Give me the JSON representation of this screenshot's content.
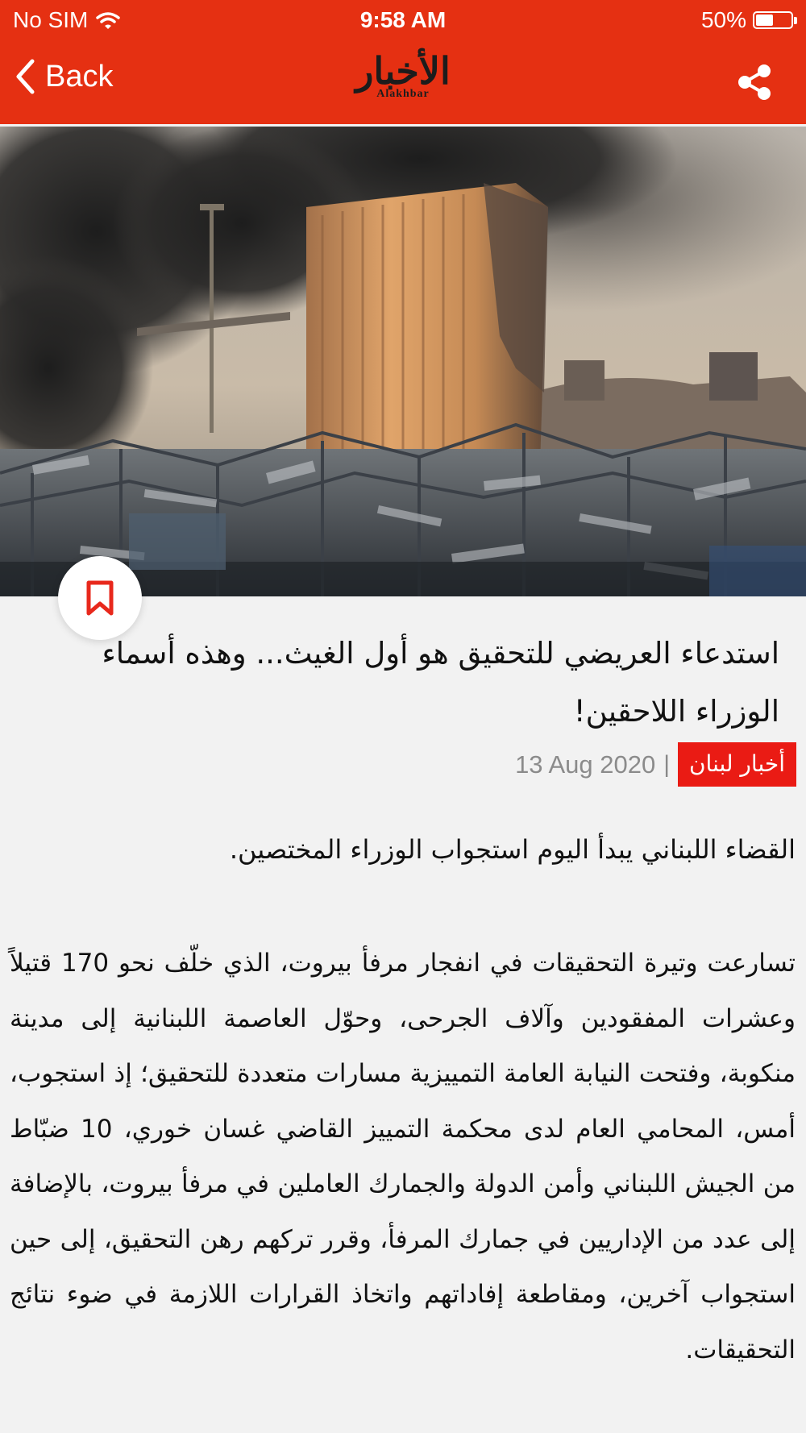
{
  "status_bar": {
    "carrier": "No SIM",
    "time": "9:58 AM",
    "battery": "50%",
    "battery_level": 0.5
  },
  "nav": {
    "back_label": "Back",
    "logo_arabic": "الأخبار",
    "logo_latin": "Alakhbar"
  },
  "icons": {
    "back": "chevron-left-icon",
    "share": "share-icon",
    "bookmark": "bookmark-icon",
    "wifi": "wifi-icon",
    "battery": "battery-icon"
  },
  "colors": {
    "header": "#e53012",
    "category": "#ea1b14",
    "bookmark": "#e8281c"
  },
  "article": {
    "title": "استدعاء العريضي للتحقيق هو أول الغيث... وهذه أسماء الوزراء اللاحقين!",
    "category": "أخبار لبنان",
    "separator": "|",
    "date": "13 Aug 2020",
    "lead": "القضاء اللبناني يبدأ اليوم استجواب الوزراء المختصين.",
    "body": "تسارعت وتيرة التحقيقات في انفجار مرفأ بيروت، الذي خلّف نحو 170 قتيلاً وعشرات المفقودين وآلاف الجرحى، وحوّل العاصمة اللبنانية إلى مدينة منكوبة، وفتحت النيابة العامة التمييزية مسارات متعددة للتحقيق؛ إذ استجوب، أمس، المحامي العام لدى محكمة التمييز القاضي غسان خوري، 10 ضبّاط من الجيش اللبناني وأمن الدولة والجمارك العاملين في مرفأ بيروت، بالإضافة إلى عدد من الإداريين في جمارك المرفأ، وقرر تركهم رهن التحقيق، إلى حين استجواب آخرين، ومقاطعة إفاداتهم واتخاذ القرارات اللازمة في ضوء نتائج التحقيقات."
  }
}
